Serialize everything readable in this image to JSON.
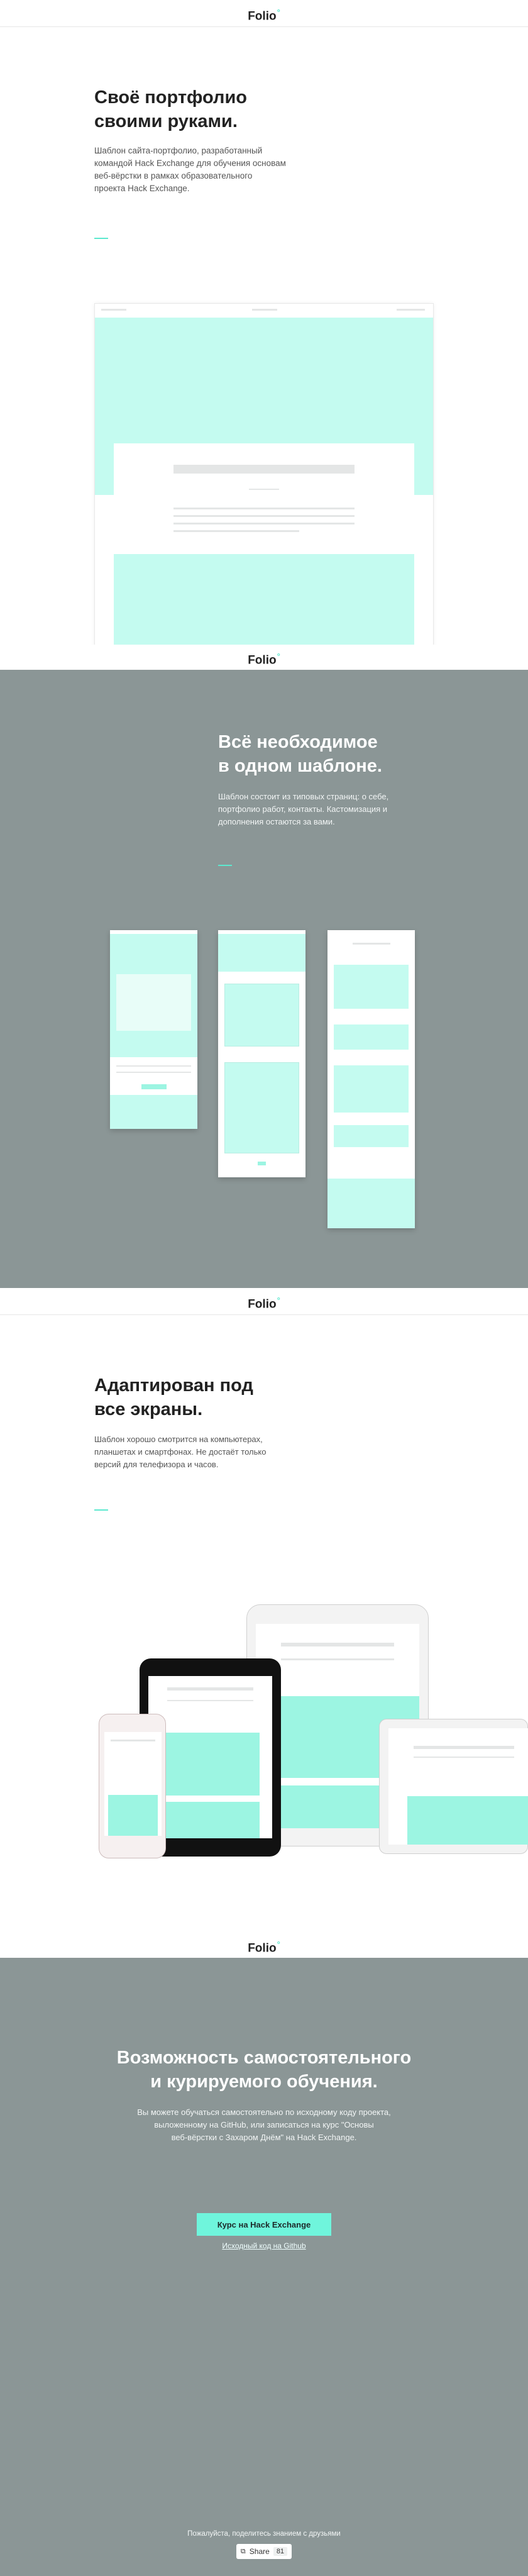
{
  "brand": {
    "name": "Folio",
    "mark": "°"
  },
  "section1": {
    "title_line1": "Своё портфолио",
    "title_line2": "своими руками.",
    "paragraph_line1": "Шаблон сайта-портфолио, разработанный",
    "paragraph_line2": "командой Hack Exchange для обучения основам",
    "paragraph_line3": "веб-вёрстки в рамках образовательного",
    "paragraph_line4": "проекта Hack Exchange."
  },
  "section2": {
    "title_line1": "Всё необходимое",
    "title_line2": "в одном шаблоне.",
    "paragraph_line1": "Шаблон состоит из типовых страниц: о себе,",
    "paragraph_line2": "портфолио работ, контакты. Кастомизация и",
    "paragraph_line3": "дополнения остаются за вами."
  },
  "section3": {
    "title_line1": "Адаптирован под",
    "title_line2": "все экраны.",
    "paragraph_line1": "Шаблон хорошо смотрится на компьютерах,",
    "paragraph_line2": "планшетах и смартфонах. Не достаёт только",
    "paragraph_line3": "версий для телефизора и часов."
  },
  "section4": {
    "title_line1": "Возможность самостоятельного",
    "title_line2": "и курируемого обучения.",
    "paragraph_line1": "Вы можете обучаться самостоятельно по исходному коду проекта,",
    "paragraph_line2": "выложенному на GitHub, или записаться на курс \"Основы",
    "paragraph_line3": "веб-вёрстки с Захаром Днём\" на Hack Exchange.",
    "cta_label": "Курс на Hack Exchange",
    "link_label": "Исходный код на Github"
  },
  "footer": {
    "text": "Пожалуйста, поделитесь знанием с друзьями",
    "share_label": "Share",
    "share_count": "81"
  },
  "colors": {
    "accent": "#5de8cf",
    "gray_bg": "#8b9696",
    "mock_teal": "#c4fbf0"
  }
}
